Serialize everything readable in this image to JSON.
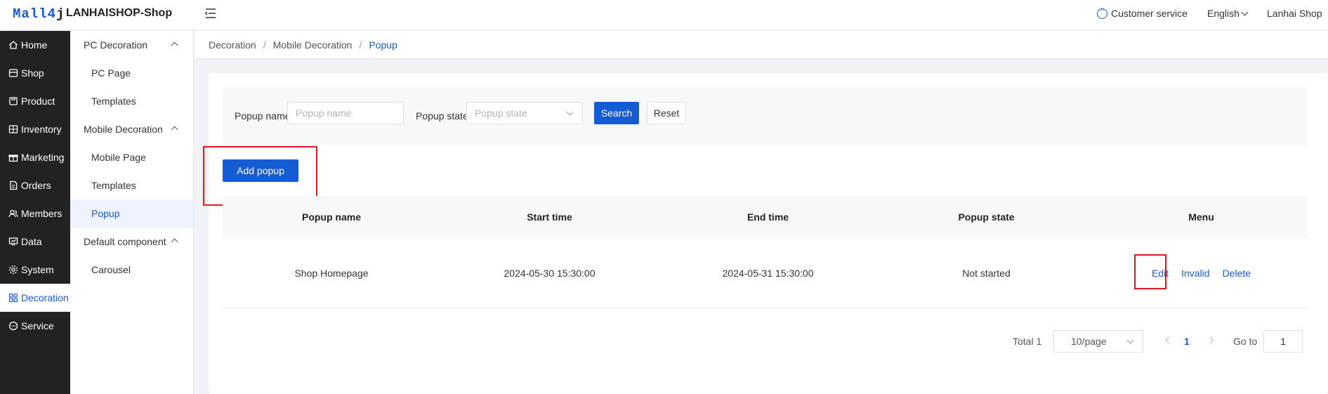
{
  "header": {
    "logo_main": "Mall4",
    "logo_j": "j",
    "shop_title": "LANHAISHOP-Shop",
    "customer_service": "Customer service",
    "language": "English",
    "user": "Lanhai Shop"
  },
  "sidebar": {
    "items": [
      {
        "label": "Home",
        "icon": "home-icon"
      },
      {
        "label": "Shop",
        "icon": "shop-icon"
      },
      {
        "label": "Product",
        "icon": "product-icon"
      },
      {
        "label": "Inventory",
        "icon": "inventory-icon"
      },
      {
        "label": "Marketing",
        "icon": "gift-icon"
      },
      {
        "label": "Orders",
        "icon": "orders-icon"
      },
      {
        "label": "Members",
        "icon": "members-icon"
      },
      {
        "label": "Data",
        "icon": "data-icon"
      },
      {
        "label": "System",
        "icon": "gear-icon"
      },
      {
        "label": "Decoration",
        "icon": "decoration-icon"
      },
      {
        "label": "Service",
        "icon": "chat-icon"
      }
    ],
    "active": "Decoration"
  },
  "submenu": {
    "groups": [
      {
        "label": "PC Decoration",
        "items": [
          "PC Page",
          "Templates"
        ]
      },
      {
        "label": "Mobile Decoration",
        "items": [
          "Mobile Page",
          "Templates",
          "Popup"
        ]
      },
      {
        "label": "Default component",
        "items": [
          "Carousel"
        ]
      }
    ],
    "active": "Popup"
  },
  "breadcrumb": {
    "items": [
      "Decoration",
      "Mobile Decoration",
      "Popup"
    ],
    "separator": "/"
  },
  "search": {
    "name_label": "Popup name",
    "name_placeholder": "Popup name",
    "name_value": "",
    "state_label": "Popup state",
    "state_placeholder": "Popup state",
    "search_button": "Search",
    "reset_button": "Reset"
  },
  "actions": {
    "add_button": "Add popup"
  },
  "table": {
    "columns": [
      "Popup name",
      "Start time",
      "End time",
      "Popup state",
      "Menu"
    ],
    "rows": [
      {
        "name": "Shop Homepage",
        "start": "2024-05-30 15:30:00",
        "end": "2024-05-31 15:30:00",
        "state": "Not started",
        "ops": [
          "Edit",
          "Invalid",
          "Delete"
        ]
      }
    ]
  },
  "pagination": {
    "total_text": "Total 1",
    "page_size": "10/page",
    "current_page": "1",
    "goto_label": "Go to",
    "goto_value": "1"
  },
  "colors": {
    "primary": "#155bd4",
    "sidebar_bg": "#222222",
    "highlight": "#e01a1a"
  }
}
